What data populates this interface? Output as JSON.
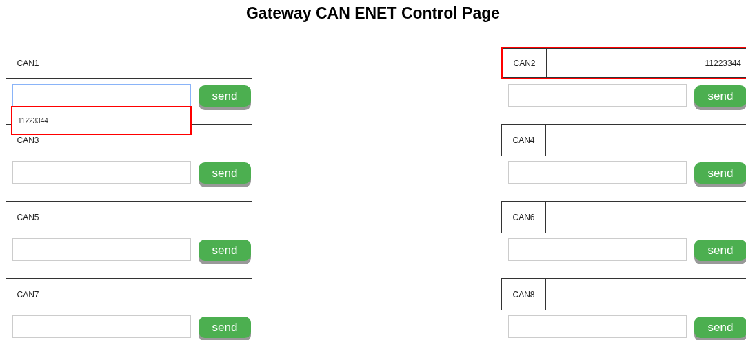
{
  "title": "Gateway CAN ENET Control Page",
  "channels": [
    {
      "label": "CAN1",
      "highlighted": false,
      "focused": true,
      "suggestions": [
        {
          "text": "11223344",
          "highlighted": true
        }
      ],
      "button": "send"
    },
    {
      "label": "CAN2",
      "value": "11223344",
      "highlighted": true,
      "focused": false,
      "button": "send"
    },
    {
      "label": "CAN3",
      "highlighted": false,
      "focused": false,
      "button": "send"
    },
    {
      "label": "CAN4",
      "highlighted": false,
      "focused": false,
      "button": "send"
    },
    {
      "label": "CAN5",
      "highlighted": false,
      "focused": false,
      "button": "send"
    },
    {
      "label": "CAN6",
      "highlighted": false,
      "focused": false,
      "button": "send"
    },
    {
      "label": "CAN7",
      "highlighted": false,
      "focused": false,
      "button": "send"
    },
    {
      "label": "CAN8",
      "highlighted": false,
      "focused": false,
      "button": "send"
    }
  ]
}
